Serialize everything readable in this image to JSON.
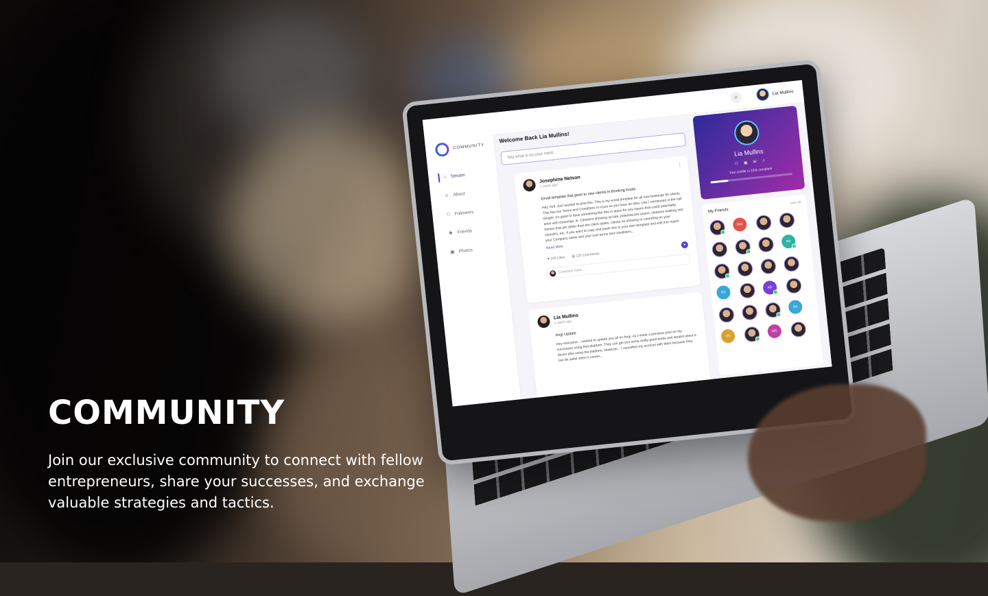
{
  "hero": {
    "title": "COMMUNITY",
    "description": "Join our exclusive community to connect with fellow entrepreneurs, share your successes, and exchange valuable strategies and tactics."
  },
  "app": {
    "brand": "COMMUNITY",
    "nav": [
      {
        "label": "Stream",
        "icon": "home-icon",
        "active": true
      },
      {
        "label": "About",
        "icon": "user-icon",
        "active": false
      },
      {
        "label": "Followers",
        "icon": "followers-icon",
        "active": false
      },
      {
        "label": "Friends",
        "icon": "friends-icon",
        "active": false
      },
      {
        "label": "Photos",
        "icon": "photo-icon",
        "active": false
      }
    ],
    "user_name": "Lia Mullins",
    "welcome": "Welcome Back Lia Mullins!",
    "compose_placeholder": "Say what is on your mind...",
    "posts": [
      {
        "author": "Josephine Nelson",
        "time": "1 week ago",
        "title": "Email template that goes to new clients in Booking Koala",
        "body": "Hey Ya'll, Just wanted to post this. This is my email template for all new bookings for clients. This has our Terms and Conditions in it just so you have an idea. Like I mentioned in the call tonight, it's good to have something like this in place for any issues that could potentially arise with cleanings, ie. Cleaners showing up late, potential pet issues, cleaners walking into homes that are dirtier than the client states, clients no showing or canceling on your cleaners, etc. If you want to copy and paste this in your own template and edit it to match your Company name and your own terms and conditions...",
        "read_more": "Read More",
        "likes": "245 Likes",
        "comments": "125 Comments",
        "comment_placeholder": "Comment Here..."
      },
      {
        "author": "Lia Mullins",
        "time": "1 week ago",
        "title": "Angi Update",
        "body": "Hey everyone... wanted to update you all on Angi, as I made a previous post on my successes using that platform. They can get you some really good leads and landed about a dozen jobs using the platform. However... I cancelled my account with them because they can be awful when it comes..."
      }
    ],
    "profile": {
      "name": "Lia Mullins",
      "complete_text": "Your profile is 22% complete",
      "complete_fraction": 0.22
    },
    "friends": {
      "title": "My Friends",
      "view_all": "View All",
      "items": [
        {
          "initials": "",
          "photo": true,
          "online": true
        },
        {
          "initials": "MW",
          "photo": false,
          "color": "#e0544b",
          "online": false
        },
        {
          "initials": "",
          "photo": true,
          "online": false
        },
        {
          "initials": "",
          "photo": true,
          "online": false
        },
        {
          "initials": "",
          "photo": true,
          "online": false
        },
        {
          "initials": "",
          "photo": true,
          "online": true
        },
        {
          "initials": "",
          "photo": true,
          "online": false
        },
        {
          "initials": "NK",
          "photo": false,
          "color": "#2fb3a3",
          "online": true
        },
        {
          "initials": "",
          "photo": true,
          "online": true
        },
        {
          "initials": "",
          "photo": true,
          "online": false
        },
        {
          "initials": "",
          "photo": true,
          "online": false
        },
        {
          "initials": "",
          "photo": true,
          "online": false
        },
        {
          "initials": "RJ",
          "photo": false,
          "color": "#3aa6d9",
          "online": false
        },
        {
          "initials": "",
          "photo": true,
          "online": false
        },
        {
          "initials": "AD",
          "photo": false,
          "color": "#7b3fd9",
          "online": true
        },
        {
          "initials": "",
          "photo": true,
          "online": false
        },
        {
          "initials": "",
          "photo": true,
          "online": false
        },
        {
          "initials": "",
          "photo": true,
          "online": false
        },
        {
          "initials": "",
          "photo": true,
          "online": true
        },
        {
          "initials": "DK",
          "photo": false,
          "color": "#3aa6d9",
          "online": false
        },
        {
          "initials": "VK",
          "photo": false,
          "color": "#d9a12f",
          "online": false
        },
        {
          "initials": "",
          "photo": true,
          "online": true
        },
        {
          "initials": "MS",
          "photo": false,
          "color": "#c23fa8",
          "online": false
        },
        {
          "initials": "",
          "photo": true,
          "online": false
        }
      ]
    }
  },
  "colors": {
    "accent": "#4b3fd9",
    "profile_gradient_start": "#2e2a9a",
    "profile_gradient_end": "#a12ba8",
    "online": "#3bd16f"
  }
}
